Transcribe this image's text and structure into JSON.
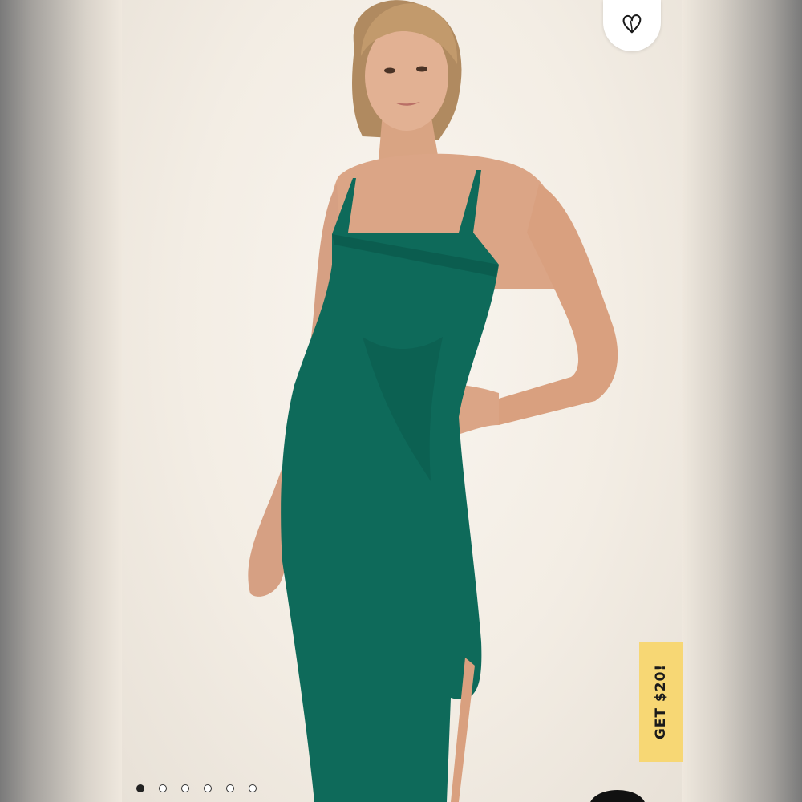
{
  "product": {
    "image_alt": "",
    "dress_color": "#0e6a5a",
    "background_color": "#f3ede4"
  },
  "favorite": {
    "icon": "heart-outline-icon"
  },
  "promo": {
    "label": "GET $20!",
    "color": "#f7d774"
  },
  "carousel": {
    "total": 6,
    "active_index": 0
  }
}
